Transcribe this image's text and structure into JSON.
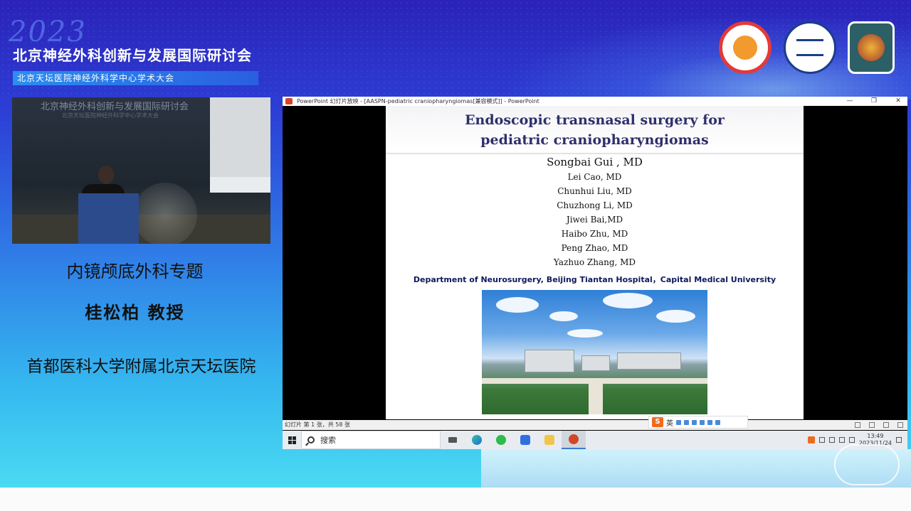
{
  "banner": {
    "year": "2023",
    "title": "北京神经外科创新与发展国际研讨会",
    "subtitle": "北京天坛医院神经外科学中心学术大会"
  },
  "video": {
    "backdrop_title": "北京神经外科创新与发展国际研讨会",
    "backdrop_subtitle": "北京天坛医院神经外科学中心学术大会"
  },
  "session": {
    "topic": "内镜颅底外科专题",
    "speaker": "桂松柏  教授",
    "affiliation": "首都医科大学附属北京天坛医院"
  },
  "ppt": {
    "window_title": "PowerPoint 幻灯片放映 - [AASPN-pediatric craniopharyngiomas[兼容模式]] - PowerPoint",
    "title_line1": "Endoscopic transnasal surgery for",
    "title_line2": "pediatric craniopharyngiomas",
    "main_author": "Songbai Gui , MD",
    "authors": [
      "Lei Cao, MD",
      "Chunhui Liu, MD",
      "Chuzhong Li, MD",
      "Jiwei Bai,MD",
      "Haibo Zhu, MD",
      "Peng Zhao, MD",
      "Yazhuo Zhang, MD"
    ],
    "department": "Department of Neurosurgery, Beijing Tiantan Hospital，Capital Medical University",
    "status_text": "幻灯片 第 1 张，共 58 张"
  },
  "ime": {
    "lang": "英"
  },
  "taskbar": {
    "search_placeholder": "搜索",
    "time": "13:49",
    "date": "2023/11/24"
  },
  "window_controls": {
    "minimize": "—",
    "restore": "❐",
    "close": "✕"
  },
  "colors": {
    "accent_blue": "#2c3fd6",
    "slide_title": "#2e2f6a",
    "department_text": "#0d1a5c",
    "ppt_orange": "#d24726"
  }
}
